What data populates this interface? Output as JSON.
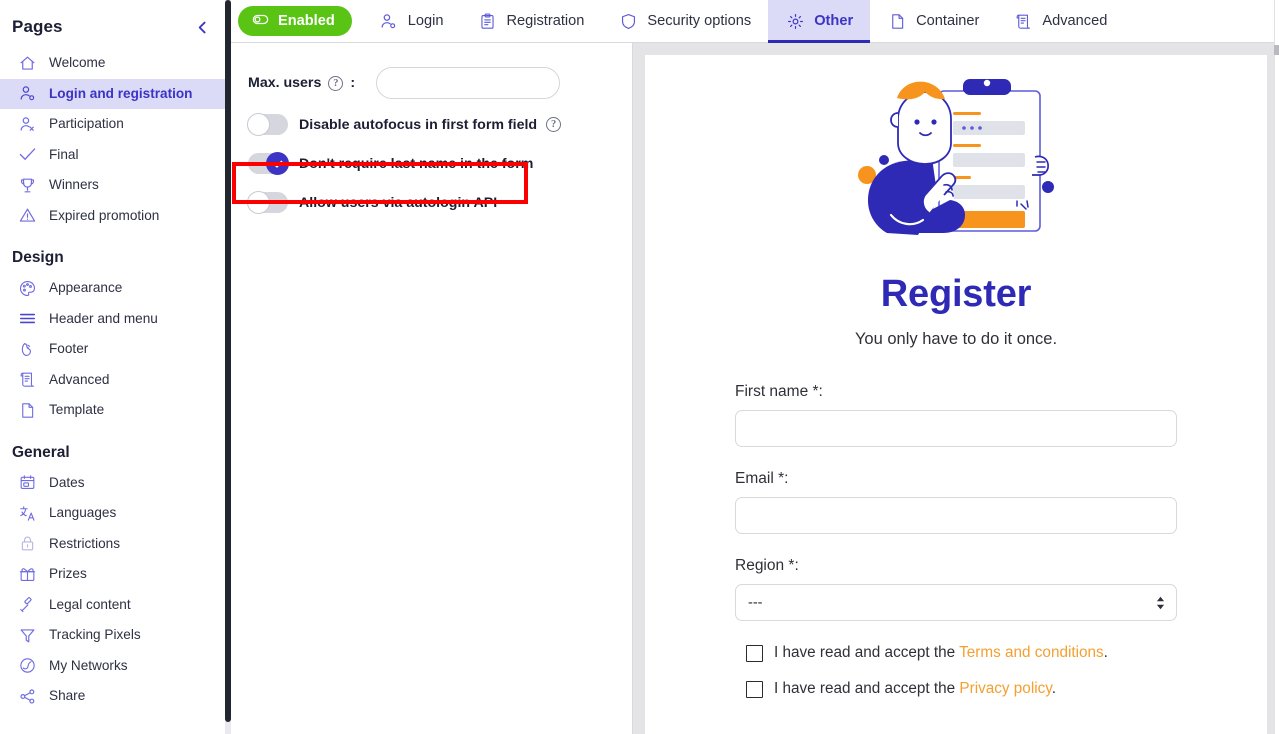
{
  "sidebar": {
    "title": "Pages",
    "collapse_icon": "chevron-left-icon",
    "groups": [
      {
        "heading": null,
        "items": [
          {
            "label": "Welcome",
            "icon": "home-icon",
            "active": false
          },
          {
            "label": "Login and registration",
            "icon": "user-key-icon",
            "active": true
          },
          {
            "label": "Participation",
            "icon": "user-plus-icon",
            "active": false
          },
          {
            "label": "Final",
            "icon": "check-icon",
            "active": false
          },
          {
            "label": "Winners",
            "icon": "trophy-icon",
            "active": false
          },
          {
            "label": "Expired promotion",
            "icon": "warning-triangle-icon",
            "active": false
          }
        ]
      },
      {
        "heading": "Design",
        "items": [
          {
            "label": "Appearance",
            "icon": "palette-icon",
            "active": false
          },
          {
            "label": "Header and menu",
            "icon": "menu-lines-icon",
            "active": false
          },
          {
            "label": "Footer",
            "icon": "shoe-icon",
            "active": false
          },
          {
            "label": "Advanced",
            "icon": "scroll-icon",
            "active": false
          },
          {
            "label": "Template",
            "icon": "page-icon",
            "active": false
          }
        ]
      },
      {
        "heading": "General",
        "items": [
          {
            "label": "Dates",
            "icon": "calendar-icon",
            "active": false
          },
          {
            "label": "Languages",
            "icon": "translate-icon",
            "active": false
          },
          {
            "label": "Restrictions",
            "icon": "lock-icon",
            "active": false
          },
          {
            "label": "Prizes",
            "icon": "gift-icon",
            "active": false
          },
          {
            "label": "Legal content",
            "icon": "gavel-icon",
            "active": false
          },
          {
            "label": "Tracking Pixels",
            "icon": "funnel-icon",
            "active": false
          },
          {
            "label": "My Networks",
            "icon": "globe-icon",
            "active": false
          },
          {
            "label": "Share",
            "icon": "share-icon",
            "active": false
          }
        ]
      }
    ]
  },
  "tabs": {
    "status_pill": {
      "label": "Enabled",
      "icon": "toggle-on-icon",
      "color": "#5ac414"
    },
    "items": [
      {
        "label": "Login",
        "icon": "user-key-icon",
        "active": false
      },
      {
        "label": "Registration",
        "icon": "clipboard-icon",
        "active": false
      },
      {
        "label": "Security options",
        "icon": "shield-icon",
        "active": false
      },
      {
        "label": "Other",
        "icon": "gear-icon",
        "active": true
      },
      {
        "label": "Container",
        "icon": "page-icon",
        "active": false
      },
      {
        "label": "Advanced",
        "icon": "scroll-icon",
        "active": false
      }
    ]
  },
  "settings": {
    "max_users": {
      "label": "Max. users",
      "suffix": ":",
      "help_icon": "question-mark-icon",
      "value": "",
      "placeholder": ""
    },
    "toggles": [
      {
        "label": "Disable autofocus in first form field",
        "on": false,
        "has_help": true,
        "highlighted": false
      },
      {
        "label": "Don't require last name in the form",
        "on": true,
        "has_help": false,
        "highlighted": true
      },
      {
        "label": "Allow users via autologin API",
        "on": false,
        "has_help": false,
        "highlighted": false
      }
    ],
    "highlight_color": "#fb0000"
  },
  "preview": {
    "illustration": "person-with-clipboard-illustration",
    "title": "Register",
    "subtitle": "You only have to do it once.",
    "title_color": "#2f2ab5",
    "fields": [
      {
        "label": "First name *:",
        "type": "text",
        "value": "",
        "placeholder": ""
      },
      {
        "label": "Email *:",
        "type": "text",
        "value": "",
        "placeholder": ""
      },
      {
        "label": "Region *:",
        "type": "select",
        "value": "---",
        "options": [
          "---"
        ]
      }
    ],
    "checkboxes": [
      {
        "checked": false,
        "prefix": "I have read and accept the ",
        "link": "Terms and conditions",
        "suffix": "."
      },
      {
        "checked": false,
        "prefix": "I have read and accept the ",
        "link": "Privacy policy",
        "suffix": "."
      }
    ],
    "link_color": "#f4a030"
  }
}
